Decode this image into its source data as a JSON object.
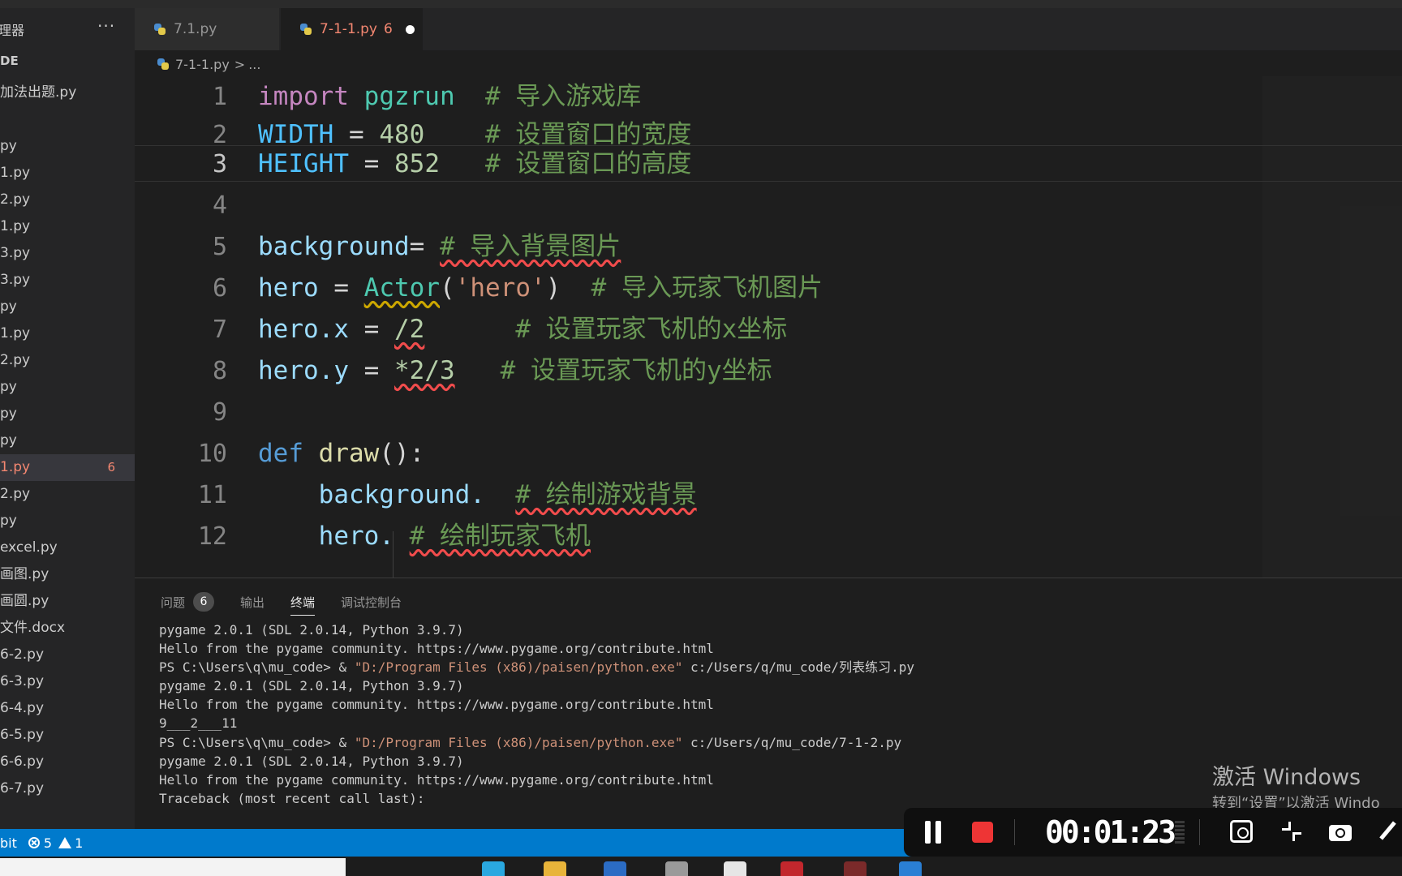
{
  "sidebar": {
    "title": "理器",
    "more": "···",
    "section": "DE",
    "items": [
      {
        "label": "加法出题.py"
      },
      {
        "label": ""
      },
      {
        "label": "py"
      },
      {
        "label": "1.py"
      },
      {
        "label": "2.py"
      },
      {
        "label": "1.py"
      },
      {
        "label": "3.py"
      },
      {
        "label": "3.py"
      },
      {
        "label": "py"
      },
      {
        "label": "1.py"
      },
      {
        "label": "2.py"
      },
      {
        "label": "py"
      },
      {
        "label": "py"
      },
      {
        "label": "py"
      },
      {
        "label": "1.py",
        "badge": "6"
      },
      {
        "label": "2.py"
      },
      {
        "label": "py"
      },
      {
        "label": "excel.py"
      },
      {
        "label": "画图.py"
      },
      {
        "label": "画圆.py"
      },
      {
        "label": "文件.docx"
      },
      {
        "label": "6-2.py"
      },
      {
        "label": "6-3.py"
      },
      {
        "label": "6-4.py"
      },
      {
        "label": "6-5.py"
      },
      {
        "label": "6-6.py"
      },
      {
        "label": "6-7.py"
      }
    ]
  },
  "tabs": [
    {
      "label": "7.1.py"
    },
    {
      "label": "7-1-1.py",
      "problems": "6"
    }
  ],
  "breadcrumb": {
    "file": "7-1-1.py",
    "sep": ">",
    "rest": "..."
  },
  "editor": {
    "lines": [
      "1",
      "2",
      "3",
      "4",
      "5",
      "6",
      "7",
      "8",
      "9",
      "10",
      "11",
      "12"
    ],
    "code": {
      "l1": {
        "kw": "import",
        "mod": "pgzrun",
        "comment": "# 导入游戏库"
      },
      "l2": {
        "name": "WIDTH",
        "eq": "=",
        "num": "480",
        "comment": "# 设置窗口的宽度"
      },
      "l3": {
        "name": "HEIGHT",
        "eq": "=",
        "num": "852",
        "comment": "# 设置窗口的高度"
      },
      "l5": {
        "name": "background",
        "eq": "=",
        "comment": "# 导入背景图片"
      },
      "l6": {
        "name": "hero",
        "eq": "=",
        "cls": "Actor",
        "open": "(",
        "str": "'hero'",
        "close": ")",
        "comment": "# 导入玩家飞机图片"
      },
      "l7": {
        "name": "hero",
        "attr": ".x",
        "eq": "=",
        "expr": "/2",
        "comment": "# 设置玩家飞机的x坐标"
      },
      "l8": {
        "name": "hero",
        "attr": ".y",
        "eq": "=",
        "expr": "*2/3",
        "comment": "# 设置玩家飞机的y坐标"
      },
      "l10": {
        "kw": "def",
        "fn": "draw",
        "paren": "():"
      },
      "l11": {
        "name": "background.",
        "comment": "# 绘制游戏背景"
      },
      "l12": {
        "name": "hero.",
        "comment": "# 绘制玩家飞机"
      }
    }
  },
  "panel": {
    "tabs": [
      {
        "label": "问题",
        "badge": "6"
      },
      {
        "label": "输出"
      },
      {
        "label": "终端"
      },
      {
        "label": "调试控制台"
      }
    ],
    "terminal": [
      {
        "text": "pygame 2.0.1 (SDL 2.0.14, Python 3.9.7)"
      },
      {
        "text": "Hello from the pygame community. https://www.pygame.org/contribute.html"
      },
      {
        "prompt": "PS C:\\Users\\q\\mu_code> & ",
        "exe": "\"D:/Program Files (x86)/paisen/python.exe\"",
        "arg": " c:/Users/q/mu_code/列表练习.py"
      },
      {
        "text": "pygame 2.0.1 (SDL 2.0.14, Python 3.9.7)"
      },
      {
        "text": "Hello from the pygame community. https://www.pygame.org/contribute.html"
      },
      {
        "text": "9___2___11"
      },
      {
        "prompt": "PS C:\\Users\\q\\mu_code> & ",
        "exe": "\"D:/Program Files (x86)/paisen/python.exe\"",
        "arg": " c:/Users/q/mu_code/7-1-2.py"
      },
      {
        "text": "pygame 2.0.1 (SDL 2.0.14, Python 3.9.7)"
      },
      {
        "text": "Hello from the pygame community. https://www.pygame.org/contribute.html"
      },
      {
        "text": "Traceback (most recent call last):"
      }
    ]
  },
  "statusbar": {
    "branch": "bit",
    "errors": "5",
    "warnings": "1"
  },
  "watermark": {
    "title": "激活 Windows",
    "subtitle": "转到“设置”以激活 Windo"
  },
  "recorder": {
    "time": "00:01:23"
  },
  "colors": {
    "statusbar": "#007acc",
    "error": "#f48771",
    "comment": "#6a9955",
    "keyword": "#c586c0",
    "stop": "#ee3535"
  }
}
